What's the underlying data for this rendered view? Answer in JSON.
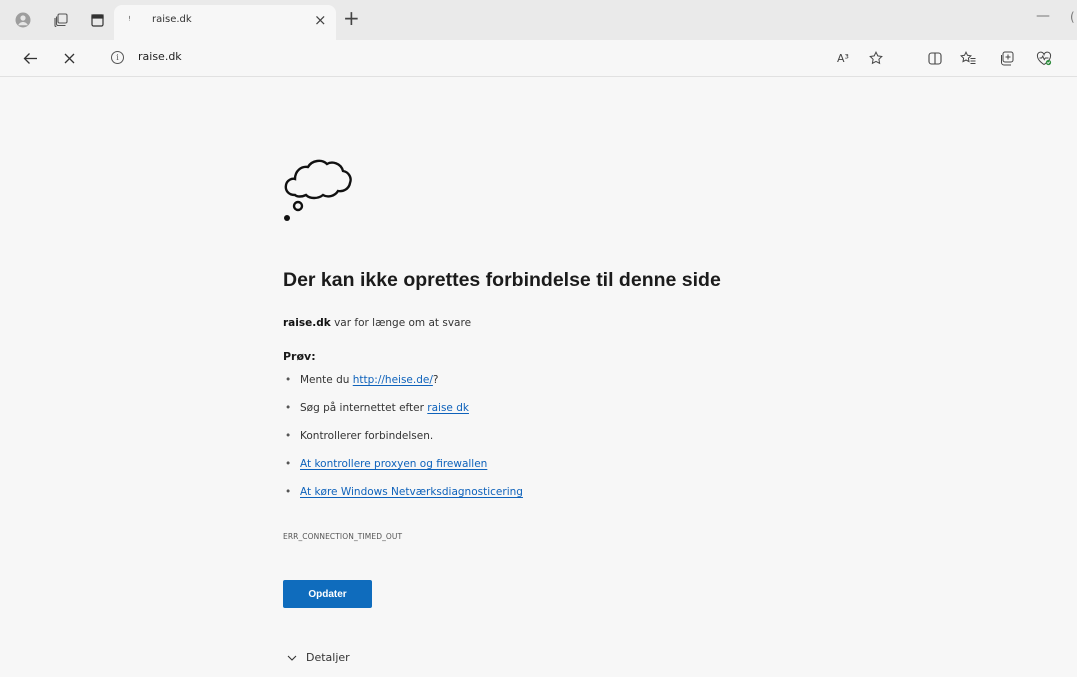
{
  "tab": {
    "favicon": "ꜝ",
    "title": "raise.dk",
    "close": "×",
    "new_tab": "+"
  },
  "window": {
    "minimize": "—",
    "edge": "("
  },
  "address": {
    "url": "raise.dk",
    "info_icon": "i",
    "read_aloud": "A³"
  },
  "icons": [
    "profile-icon",
    "workspaces-icon",
    "vertical-tabs-icon",
    "back-icon",
    "stop-loading-icon",
    "site-info-icon",
    "read-aloud-icon",
    "favorite-star-icon",
    "split-screen-icon",
    "favorites-icon",
    "collections-icon",
    "browser-essentials-icon",
    "thought-cloud-icon",
    "chevron-down-icon"
  ],
  "error": {
    "title": "Der kan ikke oprettes forbindelse til denne side",
    "host": "raise.dk",
    "description": " var for længe om at svare",
    "try_label": "Prøv:",
    "suggestions": [
      {
        "prefix": "Mente du ",
        "link": "http://heise.de/",
        "suffix": "?"
      },
      {
        "prefix": "Søg på internettet efter ",
        "link": "raise dk"
      },
      {
        "prefix": "Kontrollerer forbindelsen."
      },
      {
        "link": "At kontrollere proxyen og firewallen"
      },
      {
        "link": "At køre Windows Netværksdiagnosticering"
      }
    ],
    "code": "ERR_CONNECTION_TIMED_OUT",
    "reload_label": "Opdater",
    "details_label": "Detaljer"
  },
  "colors": {
    "accent": "#0f6cbd",
    "link": "#0e62bb",
    "background": "#f7f7f7"
  }
}
